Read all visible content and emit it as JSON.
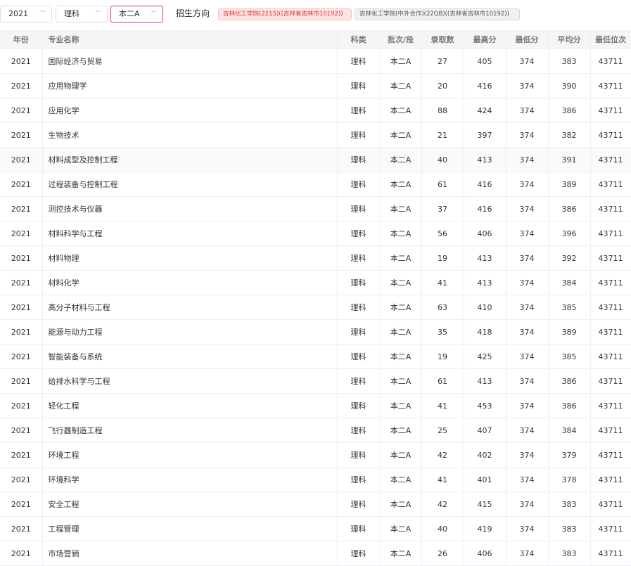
{
  "filters": {
    "year": "2021",
    "subject": "理科",
    "batch": "本二A",
    "direction_label": "招生方向",
    "directions": [
      "吉林化工学院(2215)((吉林省吉林市10192))",
      "吉林化工学院(中外合作)(22QB)((吉林省吉林市10192))"
    ]
  },
  "table": {
    "columns": [
      "年份",
      "专业名称",
      "科类",
      "批次/段",
      "录取数",
      "最高分",
      "最低分",
      "平均分",
      "最低位次"
    ],
    "rows": [
      [
        "2021",
        "国际经济与贸易",
        "理科",
        "本二A",
        "27",
        "405",
        "374",
        "383",
        "43711"
      ],
      [
        "2021",
        "应用物理学",
        "理科",
        "本二A",
        "20",
        "416",
        "374",
        "390",
        "43711"
      ],
      [
        "2021",
        "应用化学",
        "理科",
        "本二A",
        "88",
        "424",
        "374",
        "386",
        "43711"
      ],
      [
        "2021",
        "生物技术",
        "理科",
        "本二A",
        "21",
        "397",
        "374",
        "382",
        "43711"
      ],
      [
        "2021",
        "材料成型及控制工程",
        "理科",
        "本二A",
        "40",
        "413",
        "374",
        "391",
        "43711"
      ],
      [
        "2021",
        "过程装备与控制工程",
        "理科",
        "本二A",
        "61",
        "416",
        "374",
        "389",
        "43711"
      ],
      [
        "2021",
        "测控技术与仪器",
        "理科",
        "本二A",
        "37",
        "416",
        "374",
        "386",
        "43711"
      ],
      [
        "2021",
        "材料科学与工程",
        "理科",
        "本二A",
        "56",
        "406",
        "374",
        "396",
        "43711"
      ],
      [
        "2021",
        "材料物理",
        "理科",
        "本二A",
        "19",
        "413",
        "374",
        "392",
        "43711"
      ],
      [
        "2021",
        "材料化学",
        "理科",
        "本二A",
        "41",
        "413",
        "374",
        "384",
        "43711"
      ],
      [
        "2021",
        "高分子材料与工程",
        "理科",
        "本二A",
        "63",
        "410",
        "374",
        "385",
        "43711"
      ],
      [
        "2021",
        "能源与动力工程",
        "理科",
        "本二A",
        "35",
        "418",
        "374",
        "389",
        "43711"
      ],
      [
        "2021",
        "智能装备与系统",
        "理科",
        "本二A",
        "19",
        "425",
        "374",
        "385",
        "43711"
      ],
      [
        "2021",
        "给排水科学与工程",
        "理科",
        "本二A",
        "61",
        "413",
        "374",
        "386",
        "43711"
      ],
      [
        "2021",
        "轻化工程",
        "理科",
        "本二A",
        "41",
        "453",
        "374",
        "386",
        "43711"
      ],
      [
        "2021",
        "飞行器制造工程",
        "理科",
        "本二A",
        "25",
        "407",
        "374",
        "384",
        "43711"
      ],
      [
        "2021",
        "环境工程",
        "理科",
        "本二A",
        "42",
        "402",
        "374",
        "379",
        "43711"
      ],
      [
        "2021",
        "环境科学",
        "理科",
        "本二A",
        "41",
        "401",
        "374",
        "378",
        "43711"
      ],
      [
        "2021",
        "安全工程",
        "理科",
        "本二A",
        "42",
        "415",
        "374",
        "383",
        "43711"
      ],
      [
        "2021",
        "工程管理",
        "理科",
        "本二A",
        "40",
        "419",
        "374",
        "383",
        "43711"
      ],
      [
        "2021",
        "市场营销",
        "理科",
        "本二A",
        "26",
        "406",
        "374",
        "383",
        "43711"
      ]
    ]
  }
}
